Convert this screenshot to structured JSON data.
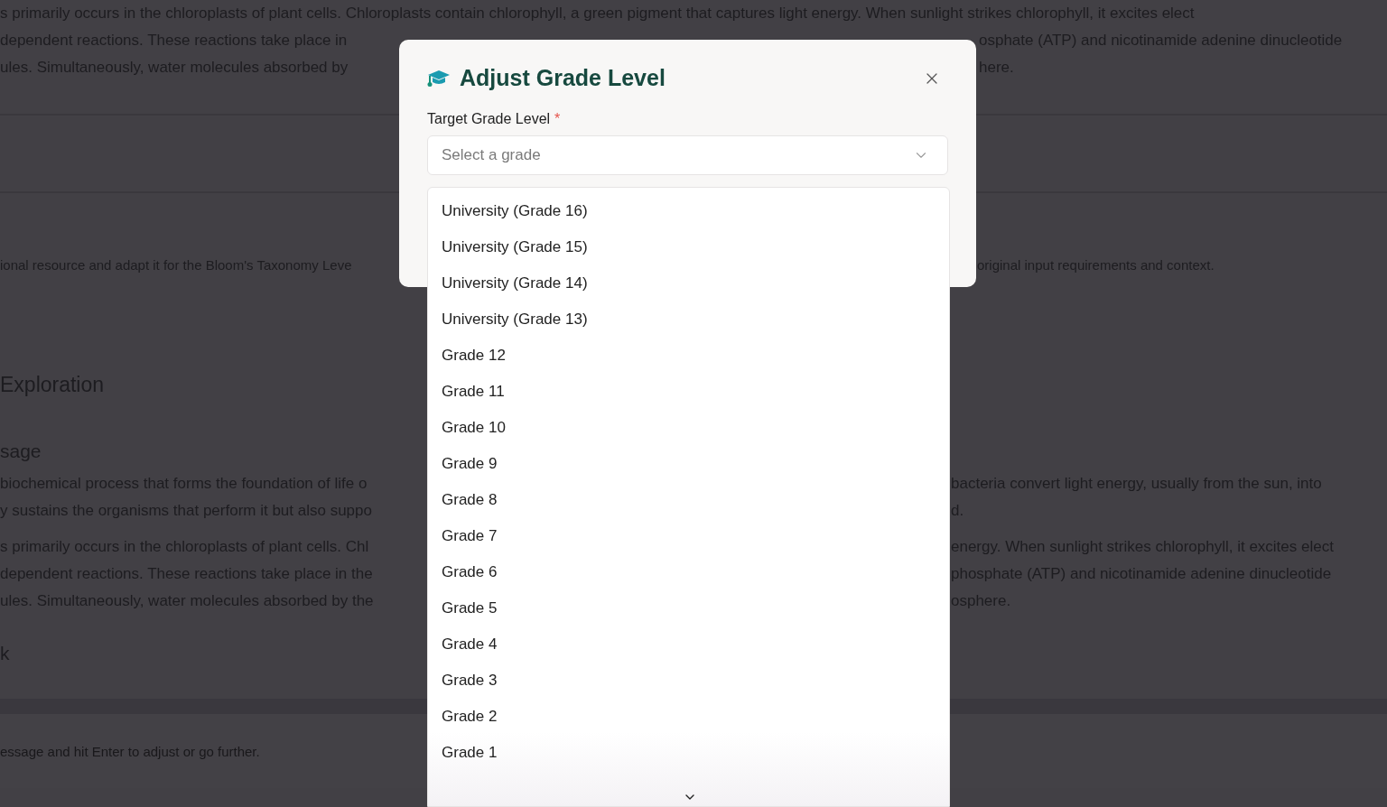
{
  "background": {
    "top_lines": [
      {
        "left": "s primarily occurs in the chloroplasts of plant cells. Chloroplasts contain chlorophyll, a green pigment that captures light energy. When sunlight strikes chlorophyll, it excites elect"
      },
      {
        "left": "dependent reactions. These reactions take place in",
        "right": "osphate (ATP) and nicotinamide adenine dinucleotide"
      },
      {
        "left": "ules. Simultaneously, water molecules absorbed by",
        "right": "here."
      }
    ],
    "instruction": {
      "left": "ional resource and adapt it for the Bloom's Taxonomy Leve",
      "right": "original input requirements and context."
    },
    "section_heading": "Exploration",
    "sub_heading": "sage",
    "body_lines": [
      {
        "left": "biochemical process that forms the foundation of life o",
        "right": "bacteria convert light energy, usually from the sun, into"
      },
      {
        "left": "y sustains the organisms that perform it but also suppo",
        "right": "d."
      },
      {
        "left": "s primarily occurs in the chloroplasts of plant cells. Chl",
        "right": "energy. When sunlight strikes chlorophyll, it excites elect"
      },
      {
        "left": "dependent reactions. These reactions take place in the",
        "right": "phosphate (ATP) and nicotinamide adenine dinucleotide"
      },
      {
        "left": "ules. Simultaneously, water molecules absorbed by the",
        "right": "osphere."
      }
    ],
    "last_heading": "k",
    "composer_placeholder": "essage and hit Enter to adjust or go further."
  },
  "dialog": {
    "title": "Adjust Grade Level",
    "field_label": "Target Grade Level",
    "required_mark": "*",
    "select": {
      "placeholder": "Select a grade"
    },
    "options": [
      {
        "label": "University (Grade 16)",
        "selected": false
      },
      {
        "label": "University (Grade 15)",
        "selected": false
      },
      {
        "label": "University (Grade 14)",
        "selected": false
      },
      {
        "label": "University (Grade 13)",
        "selected": false
      },
      {
        "label": "Grade 12",
        "selected": false
      },
      {
        "label": "Grade 11",
        "selected": false
      },
      {
        "label": "Grade 10",
        "selected": false
      },
      {
        "label": "Grade 9",
        "selected": false
      },
      {
        "label": "Grade 8",
        "selected": false
      },
      {
        "label": "Grade 7",
        "selected": false
      },
      {
        "label": "Grade 6",
        "selected": false
      },
      {
        "label": "Grade 5",
        "selected": false
      },
      {
        "label": "Grade 4",
        "selected": false
      },
      {
        "label": "Grade 3",
        "selected": false
      },
      {
        "label": "Grade 2",
        "selected": false
      },
      {
        "label": "Grade 1",
        "selected": false
      }
    ]
  }
}
